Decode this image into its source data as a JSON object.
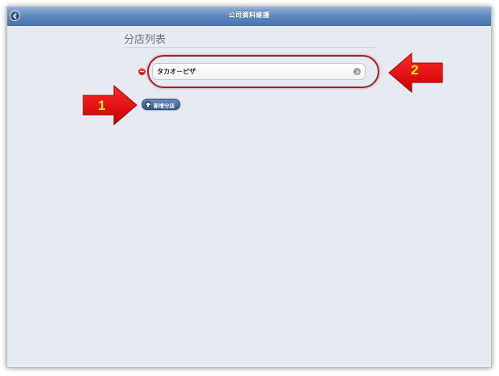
{
  "topbar": {
    "title": "公司資料維護"
  },
  "section": {
    "title": "分店列表"
  },
  "branches": [
    {
      "name": "タカオ－ピザ"
    }
  ],
  "actions": {
    "add_branch_label": "新增分店"
  },
  "callouts": [
    {
      "number": "1"
    },
    {
      "number": "2"
    }
  ],
  "colors": {
    "topbar": "#5a84bb",
    "background": "#e6eaf1",
    "callout_arrow": "#e60000",
    "callout_text": "#ffea00",
    "highlight": "#a91e24"
  }
}
